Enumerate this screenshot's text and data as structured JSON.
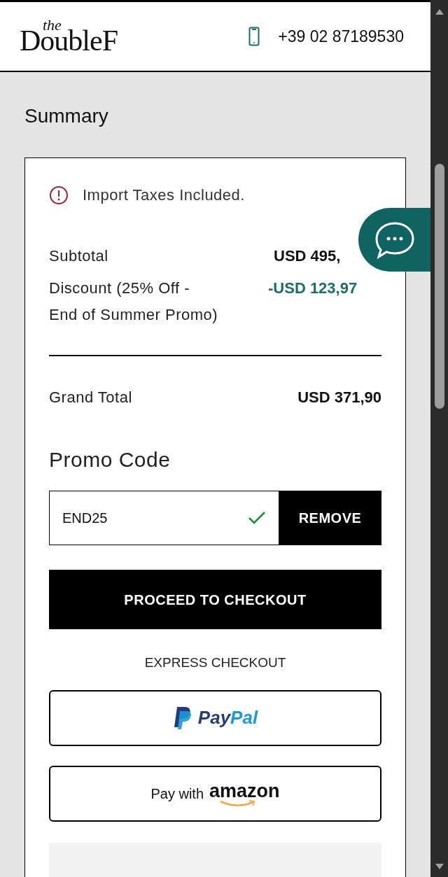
{
  "header": {
    "logo": {
      "small": "the",
      "main": "DoubleF"
    },
    "phone": "+39 02 87189530"
  },
  "summary": {
    "title": "Summary",
    "notice": "Import Taxes Included.",
    "lines": [
      {
        "kind": "normal",
        "label": "Subtotal",
        "value": "USD 495,"
      },
      {
        "kind": "discount",
        "label": "Discount (25% Off - End of Summer Promo)",
        "value": "-USD 123,97"
      }
    ],
    "grand_total": {
      "label": "Grand Total",
      "value": "USD 371,90"
    },
    "promo": {
      "title": "Promo Code",
      "value": "END25",
      "valid": true,
      "button": "REMOVE"
    },
    "checkout_button": "PROCEED TO CHECKOUT",
    "express_label": "EXPRESS CHECKOUT",
    "paypal": {
      "pay": "Pay",
      "pal": "Pal"
    },
    "amazon": {
      "prefix": "Pay with",
      "brand": "amazon"
    }
  }
}
